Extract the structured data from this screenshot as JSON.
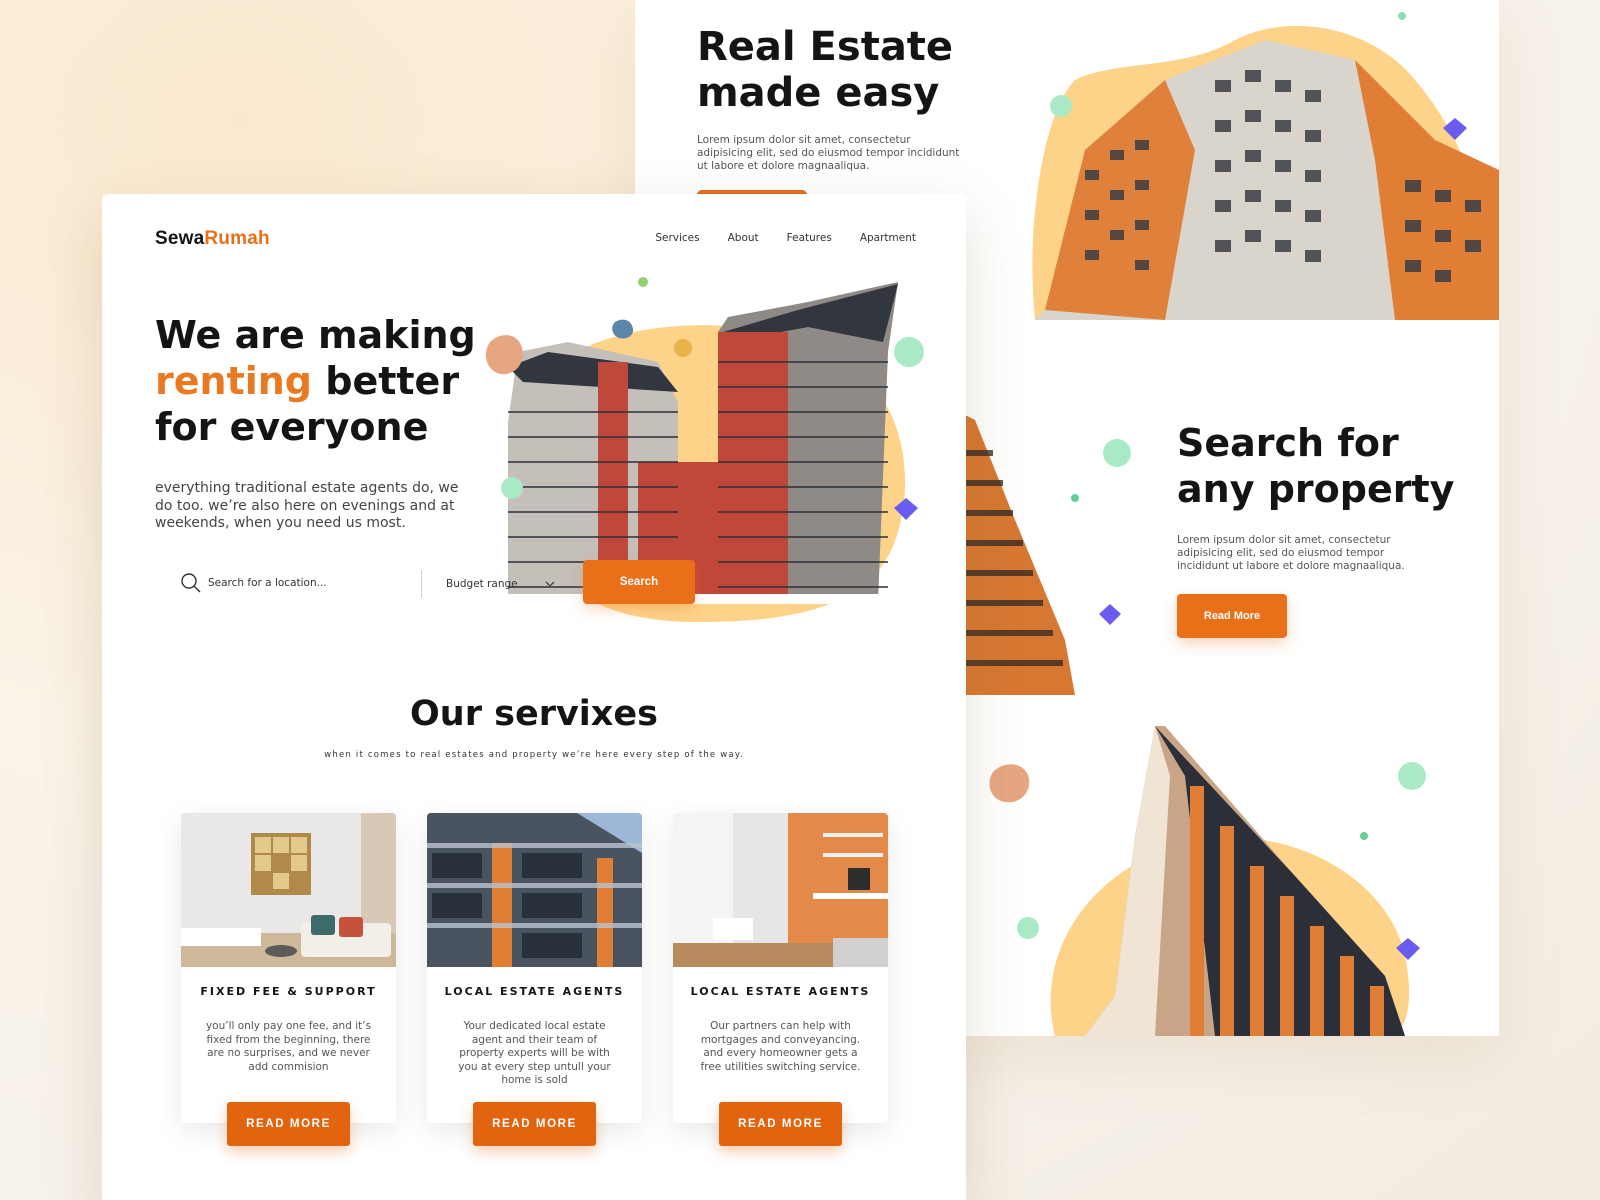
{
  "back": {
    "hero_title": "Real Estate made easy",
    "hero_text": "Lorem ipsum dolor sit amet, consectetur adipisicing elit, sed do eiusmod  tempor incididunt ut labore et dolore magnaaliqua.",
    "search_title": "Search for any property",
    "search_text": "Lorem ipsum dolor sit amet, consectetur adipisicing elit, sed do eiusmod  tempor incididunt ut labore et dolore magnaaliqua.",
    "read_more_label": "Read More"
  },
  "brand": {
    "part1": "Sewa",
    "part2": "Rumah"
  },
  "nav": {
    "services": "Services",
    "about": "About",
    "features": "Features",
    "apartment": "Apartment"
  },
  "hero": {
    "line1": "We are making",
    "accent": "renting",
    "line2_rest": " better",
    "line3": "for everyone",
    "subtitle": "everything traditional estate agents do, we do too. we’re also here on evenings and at weekends, when you need us most."
  },
  "search": {
    "placeholder": "Search for a location...",
    "budget_label": "Budget range",
    "button_label": "Search"
  },
  "services": {
    "title": "Our servixes",
    "subtitle": "when it comes to real estates and property we’re here every step of the way.",
    "cards": [
      {
        "title": "FIXED FEE & SUPPORT",
        "desc": "you’ll only pay one fee, and it’s fixed from the beginning, there are no surprises, and we never add commision",
        "button": "READ MORE"
      },
      {
        "title": "LOCAL ESTATE AGENTS",
        "desc": "Your dedicated local estate agent and their team of property experts will be with you at every step untull your home is sold",
        "button": "READ MORE"
      },
      {
        "title": "LOCAL ESTATE AGENTS",
        "desc": "Our partners can help with mortgages and conveyancing. and every homeowner gets a free utilities switching service.",
        "button": "READ MORE"
      }
    ]
  },
  "colors": {
    "accent": "#ea6f19",
    "blob": "#fdd38a",
    "sphere": "#a9e9c6",
    "gem": "#6b5cf0"
  }
}
